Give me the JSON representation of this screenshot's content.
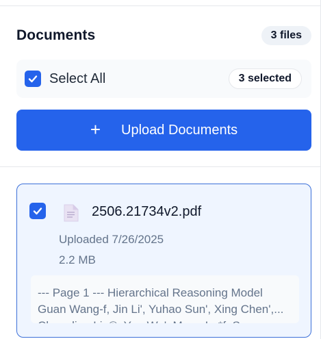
{
  "header": {
    "title": "Documents",
    "file_count": "3 files"
  },
  "select_all": {
    "label": "Select All",
    "checked": true,
    "selected_count": "3 selected"
  },
  "upload": {
    "icon": "plus-icon",
    "label": "Upload Documents"
  },
  "documents": [
    {
      "file_name": "2506.21734v2.pdf",
      "uploaded": "Uploaded 7/26/2025",
      "size": "2.2 MB",
      "checked": true,
      "icon": "file-icon",
      "preview_lines": [
        "--- Page 1 --- Hierarchical Reasoning Model",
        "Guan Wang-f, Jin Li', Yuhao Sun', Xing Chen',...",
        "Changling Liu®, Yue Wu', Meng Lu*f, Sen..."
      ]
    }
  ],
  "colors": {
    "accent": "#2563eb",
    "card_border": "#3b6fd8",
    "card_bg": "#eff5ff",
    "muted_text": "#64748b"
  }
}
